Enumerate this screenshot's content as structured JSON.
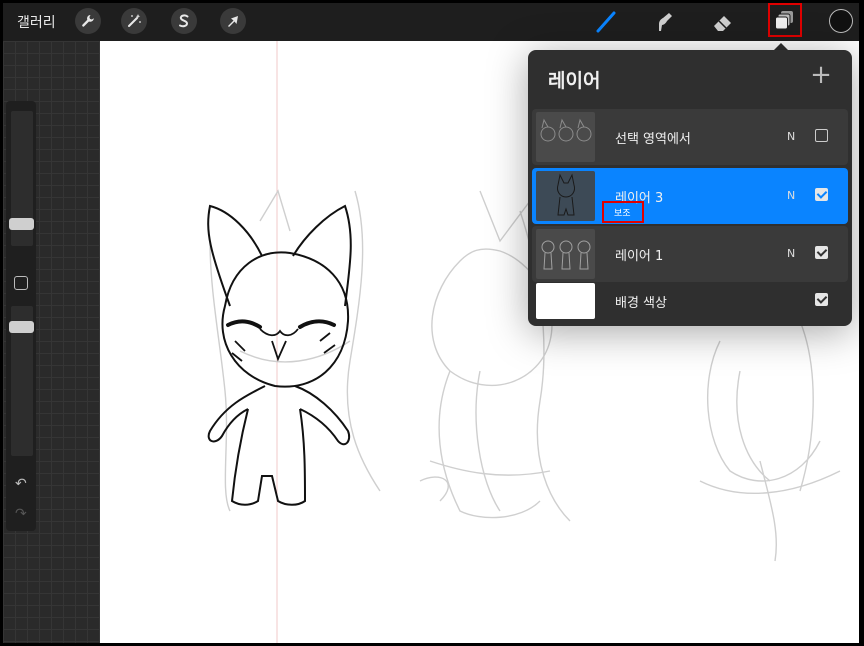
{
  "toolbar": {
    "gallery_label": "갤러리",
    "accent_color": "#0a84ff"
  },
  "panel": {
    "title": "레이어",
    "add_symbol": "+",
    "layers": [
      {
        "name": "선택 영역에서",
        "blend": "N",
        "visible": false
      },
      {
        "name": "레이어 3",
        "blend": "N",
        "visible": true,
        "active": true,
        "sub_label": "보조"
      },
      {
        "name": "레이어 1",
        "blend": "N",
        "visible": true
      },
      {
        "name": "배경 색상",
        "visible": true
      }
    ]
  },
  "sidebar": {
    "undo_symbol": "↶",
    "redo_symbol": "↷"
  },
  "icons": {
    "wrench": "wrench-icon",
    "magic": "magic-wand-icon",
    "selection": "selection-s-icon",
    "transform": "transform-arrow-icon",
    "brush": "brush-icon",
    "smudge": "smudge-icon",
    "eraser": "eraser-icon",
    "layers": "layers-icon"
  }
}
